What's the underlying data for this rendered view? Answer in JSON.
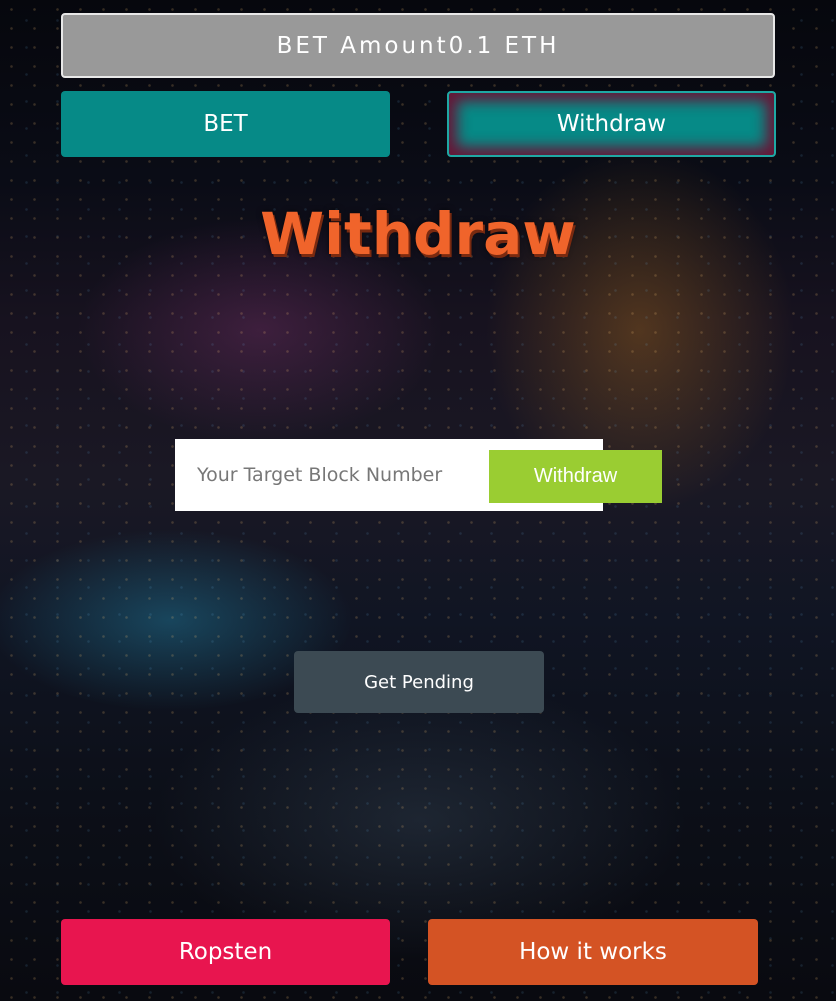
{
  "bet_amount": {
    "label": "BET Amount",
    "value": "0.1 ETH"
  },
  "top_buttons": {
    "bet": "BET",
    "withdraw": "Withdraw"
  },
  "section_title": "Withdraw",
  "target_block": {
    "placeholder": "Your Target Block Number",
    "value": "",
    "button_label": "Withdraw"
  },
  "get_pending_label": "Get Pending",
  "bottom_buttons": {
    "network": "Ropsten",
    "how_it_works": "How it works"
  },
  "colors": {
    "teal": "#068a87",
    "orange_title": "#f0642b",
    "green_button": "#9acd32",
    "slate_button": "#3c4a53",
    "pink_button": "#e8154f",
    "orange_button": "#d45324"
  }
}
